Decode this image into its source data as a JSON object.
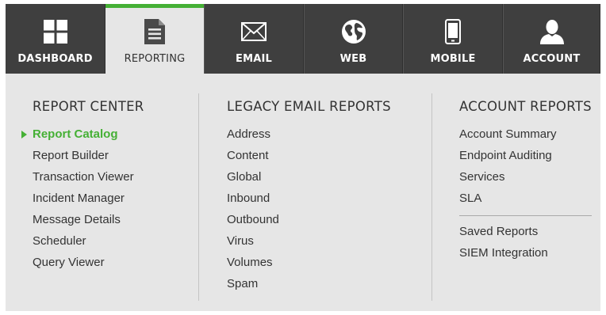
{
  "nav": {
    "tabs": [
      {
        "label": "DASHBOARD",
        "icon": "grid-icon"
      },
      {
        "label": "REPORTING",
        "icon": "document-icon",
        "active": true
      },
      {
        "label": "EMAIL",
        "icon": "envelope-icon"
      },
      {
        "label": "WEB",
        "icon": "globe-icon"
      },
      {
        "label": "MOBILE",
        "icon": "phone-icon"
      },
      {
        "label": "ACCOUNT",
        "icon": "user-icon"
      }
    ]
  },
  "report_center": {
    "title": "REPORT CENTER",
    "items": [
      "Report Catalog",
      "Report Builder",
      "Transaction Viewer",
      "Incident Manager",
      "Message Details",
      "Scheduler",
      "Query Viewer"
    ],
    "selected": "Report Catalog"
  },
  "legacy_email_reports": {
    "title": "LEGACY EMAIL REPORTS",
    "items": [
      "Address",
      "Content",
      "Global",
      "Inbound",
      "Outbound",
      "Virus",
      "Volumes",
      "Spam"
    ]
  },
  "account_reports": {
    "title": "ACCOUNT REPORTS",
    "items": [
      "Account Summary",
      "Endpoint Auditing",
      "Services",
      "SLA"
    ],
    "extra_items": [
      "Saved Reports",
      "SIEM Integration"
    ]
  },
  "colors": {
    "accent": "#45b035",
    "nav_bg": "#3f3f3f",
    "panel_bg": "#e6e6e6"
  }
}
